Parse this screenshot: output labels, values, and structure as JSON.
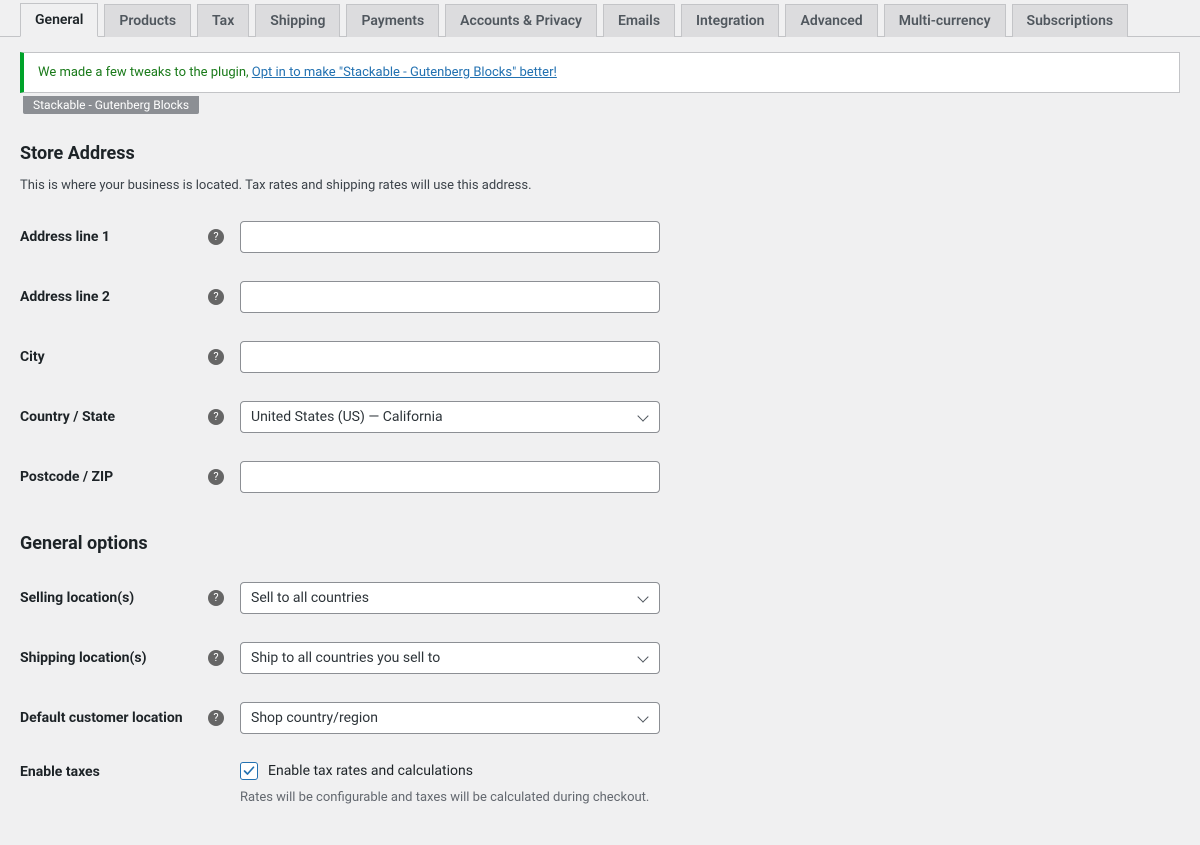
{
  "tabs": [
    {
      "label": "General"
    },
    {
      "label": "Products"
    },
    {
      "label": "Tax"
    },
    {
      "label": "Shipping"
    },
    {
      "label": "Payments"
    },
    {
      "label": "Accounts & Privacy"
    },
    {
      "label": "Emails"
    },
    {
      "label": "Integration"
    },
    {
      "label": "Advanced"
    },
    {
      "label": "Multi-currency"
    },
    {
      "label": "Subscriptions"
    }
  ],
  "notice": {
    "text": "We made a few tweaks to the plugin, ",
    "link_text": "Opt in to make \"Stackable - Gutenberg Blocks\" better!",
    "tag": "Stackable - Gutenberg Blocks"
  },
  "sections": {
    "store_address": {
      "title": "Store Address",
      "desc": "This is where your business is located. Tax rates and shipping rates will use this address."
    },
    "general_options": {
      "title": "General options"
    }
  },
  "fields": {
    "address1": {
      "label": "Address line 1",
      "value": ""
    },
    "address2": {
      "label": "Address line 2",
      "value": ""
    },
    "city": {
      "label": "City",
      "value": ""
    },
    "country": {
      "label": "Country / State",
      "value": "United States (US) — California"
    },
    "postcode": {
      "label": "Postcode / ZIP",
      "value": ""
    },
    "selling": {
      "label": "Selling location(s)",
      "value": "Sell to all countries"
    },
    "shipping": {
      "label": "Shipping location(s)",
      "value": "Ship to all countries you sell to"
    },
    "default_loc": {
      "label": "Default customer location",
      "value": "Shop country/region"
    },
    "enable_taxes": {
      "label": "Enable taxes",
      "checkbox_label": "Enable tax rates and calculations",
      "desc": "Rates will be configurable and taxes will be calculated during checkout.",
      "checked": true
    }
  }
}
